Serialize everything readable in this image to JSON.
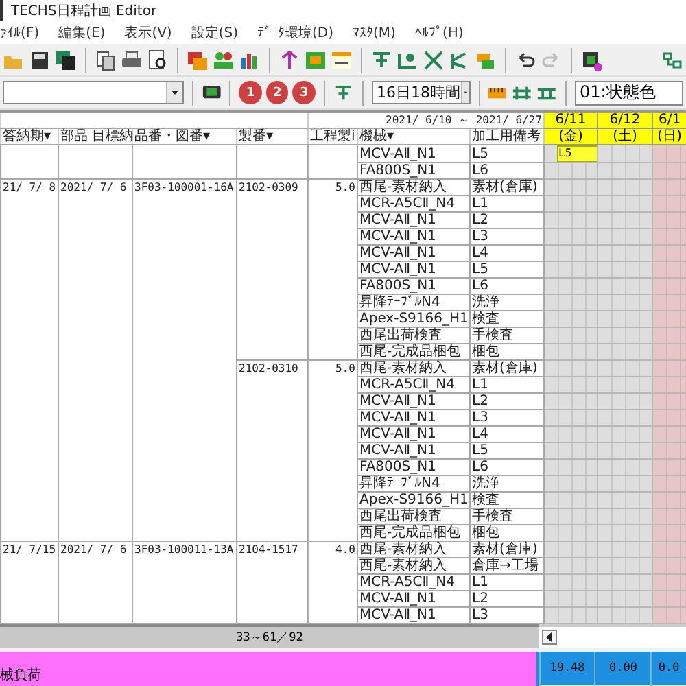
{
  "window": {
    "title": "TECHS日程計画 Editor"
  },
  "menu": [
    "ｧｲﾙ(F)",
    "編集(E)",
    "表示(V)",
    "設定(S)",
    "ﾃﾞｰﾀ環境(D)",
    "ﾏｽﾀ(M)",
    "ﾍﾙﾌﾟ(H)"
  ],
  "toolbar2": {
    "view_buttons": [
      "1",
      "2",
      "3"
    ],
    "span": "16日18時間",
    "color_mode": "01:状態色"
  },
  "grid": {
    "range": "2021/ 6/10 ～ 2021/ 6/27",
    "columns": [
      "答納期▾",
      "部品 目標納",
      "品番・図番▾",
      "製番▾",
      "工程製i",
      "機械▾",
      "加工用備考"
    ],
    "days": [
      {
        "date": "6/11",
        "weekday": "(金)",
        "kind": "weekday"
      },
      {
        "date": "6/12",
        "weekday": "(土)",
        "kind": "saturday"
      },
      {
        "date": "6/1",
        "weekday": "(日)",
        "kind": "sunday"
      }
    ],
    "orders": [
      {
        "lots": [
          {
            "ops": [
              {
                "machine": "MCV-AⅡ_N1",
                "note": "L5",
                "schedule": [
                  {
                    "label": "L5"
                  }
                ]
              },
              {
                "machine": "FA800S_N1",
                "note": "L6"
              }
            ]
          }
        ]
      },
      {
        "answer_date": "21/ 7/ 8",
        "target_date": "2021/ 7/ 6",
        "part_no": "3F03-100001-16A",
        "lots": [
          {
            "lot_no": "2102-0309",
            "hours": "5.0",
            "ops": [
              {
                "machine": "西尾-素材納入",
                "note": "素材(倉庫)"
              },
              {
                "machine": "MCR-A5CⅡ_N4",
                "note": "L1"
              },
              {
                "machine": "MCV-AⅡ_N1",
                "note": "L2"
              },
              {
                "machine": "MCV-AⅡ_N1",
                "note": "L3"
              },
              {
                "machine": "MCV-AⅡ_N1",
                "note": "L4"
              },
              {
                "machine": "MCV-AⅡ_N1",
                "note": "L5"
              },
              {
                "machine": "FA800S_N1",
                "note": "L6"
              },
              {
                "machine": "昇降ﾃｰﾌﾞﾙN4",
                "note": "洗浄"
              },
              {
                "machine": "Apex-S9166_H1",
                "note": "検査"
              },
              {
                "machine": "西尾出荷検査",
                "note": "手検査"
              },
              {
                "machine": "西尾-完成品梱包",
                "note": "梱包"
              }
            ]
          },
          {
            "lot_no": "2102-0310",
            "hours": "5.0",
            "ops": [
              {
                "machine": "西尾-素材納入",
                "note": "素材(倉庫)"
              },
              {
                "machine": "MCR-A5CⅡ_N4",
                "note": "L1"
              },
              {
                "machine": "MCV-AⅡ_N1",
                "note": "L2"
              },
              {
                "machine": "MCV-AⅡ_N1",
                "note": "L3"
              },
              {
                "machine": "MCV-AⅡ_N1",
                "note": "L4"
              },
              {
                "machine": "MCV-AⅡ_N1",
                "note": "L5"
              },
              {
                "machine": "FA800S_N1",
                "note": "L6"
              },
              {
                "machine": "昇降ﾃｰﾌﾞﾙN4",
                "note": "洗浄"
              },
              {
                "machine": "Apex-S9166_H1",
                "note": "検査"
              },
              {
                "machine": "西尾出荷検査",
                "note": "手検査"
              },
              {
                "machine": "西尾-完成品梱包",
                "note": "梱包"
              }
            ]
          }
        ]
      },
      {
        "answer_date": "21/ 7/15",
        "target_date": "2021/ 7/ 6",
        "part_no": "3F03-100011-13A",
        "lots": [
          {
            "lot_no": "2104-1517",
            "hours": "4.0",
            "ops": [
              {
                "machine": "西尾-素材納入",
                "note": "素材(倉庫)"
              },
              {
                "machine": "西尾-素材納入",
                "note": "倉庫→工場"
              },
              {
                "machine": "MCR-A5CⅡ_N4",
                "note": "L1"
              },
              {
                "machine": "MCV-AⅡ_N1",
                "note": "L2"
              },
              {
                "machine": "MCV-AⅡ_N1",
                "note": "L3"
              }
            ]
          }
        ]
      }
    ]
  },
  "status": {
    "records": "33～61／92"
  },
  "load": {
    "label": "械負荷",
    "values": [
      "19.48",
      "0.00",
      "0.0"
    ]
  }
}
